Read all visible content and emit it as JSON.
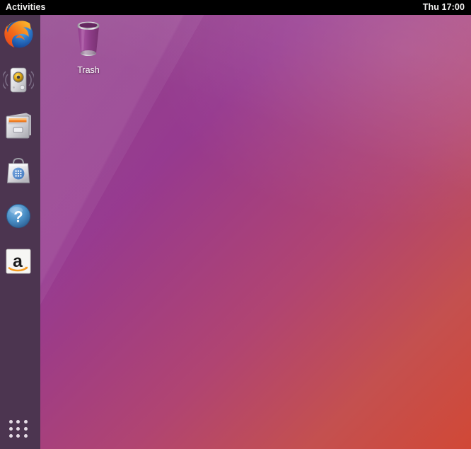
{
  "topbar": {
    "activities_label": "Activities",
    "clock": "Thu 17:00",
    "background_color": "#000000",
    "text_color": "#f2f1f0"
  },
  "dock": {
    "background_color": "#4c3550",
    "items": [
      {
        "name": "firefox",
        "label": "Firefox Web Browser",
        "icon": "firefox-icon"
      },
      {
        "name": "rhythmbox",
        "label": "Rhythmbox",
        "icon": "speaker-icon"
      },
      {
        "name": "files",
        "label": "Files",
        "icon": "file-cabinet-icon"
      },
      {
        "name": "ubuntu-software",
        "label": "Ubuntu Software",
        "icon": "shopping-bag-icon"
      },
      {
        "name": "help",
        "label": "Help",
        "icon": "question-mark-icon"
      },
      {
        "name": "amazon",
        "label": "Amazon",
        "icon": "amazon-icon"
      }
    ],
    "show_apps_label": "Show Applications"
  },
  "desktop": {
    "icons": [
      {
        "name": "trash",
        "label": "Trash",
        "icon": "trash-bin-icon"
      }
    ],
    "wallpaper": {
      "top_left_color": "#8c3f88",
      "top_right_color": "#bd4e5e",
      "bottom_left_color": "#96398f",
      "bottom_right_color": "#d14836"
    }
  }
}
